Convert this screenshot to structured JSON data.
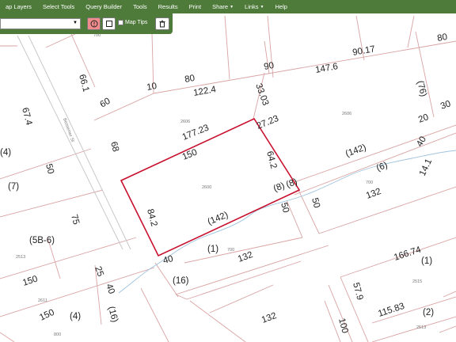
{
  "menu": {
    "items": [
      {
        "label": "ap Layers",
        "caret": false
      },
      {
        "label": "Select Tools",
        "caret": false
      },
      {
        "label": "Query Builder",
        "caret": false
      },
      {
        "label": "Tools",
        "caret": false
      },
      {
        "label": "Results",
        "caret": false
      },
      {
        "label": "Print",
        "caret": false
      },
      {
        "label": "Share",
        "caret": true
      },
      {
        "label": "Links",
        "caret": true
      },
      {
        "label": "Help",
        "caret": false
      }
    ]
  },
  "toolbar": {
    "select_value": "",
    "map_tips_label": "Map Tips",
    "map_tips_checked": false
  },
  "map": {
    "street_name": "Bessemer St",
    "highlight_color": "#c8102e",
    "parcel_line_color": "#d9a3a3",
    "dimension_labels": [
      "66.1",
      "60",
      "10",
      "80",
      "122.4",
      "90",
      "33.03",
      "90.17",
      "147.6",
      "80",
      "(76)",
      "30",
      "67.4",
      "68",
      "177.23",
      "27.23",
      "20",
      "40",
      "150",
      "64.2",
      "(142)",
      "(6)",
      "14.1",
      "(7)",
      "50",
      "(8)",
      "(8)",
      "132",
      "75",
      "84.2",
      "(142)",
      "50",
      "50",
      "(5B-6)",
      "(1)",
      "40",
      "132",
      "166.74",
      "(1)",
      "25",
      "150",
      "40",
      "(16)",
      "57.9",
      "115.83",
      "(2)",
      "150",
      "(4)",
      "(16)",
      "132",
      "100",
      "(4)"
    ],
    "number_labels": [
      "700",
      "2606",
      "2606",
      "2600",
      "700",
      "700",
      "2513",
      "2515",
      "2611",
      "2513",
      "800"
    ]
  }
}
